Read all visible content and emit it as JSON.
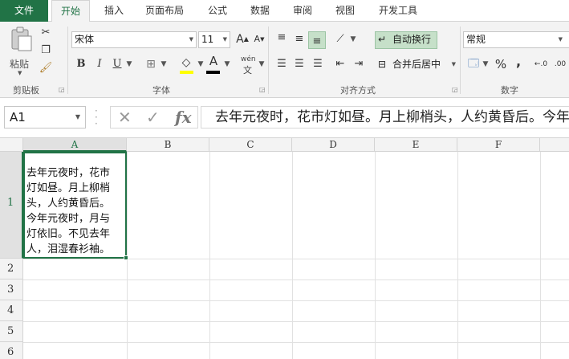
{
  "ribbon_tabs": [
    "文件",
    "开始",
    "插入",
    "页面布局",
    "公式",
    "数据",
    "审阅",
    "视图",
    "开发工具"
  ],
  "clipboard": {
    "paste_label": "粘贴",
    "group_label": "剪贴板"
  },
  "font": {
    "name": "宋体",
    "size": "11",
    "group_label": "字体",
    "bold": "B",
    "italic": "I",
    "underline": "U",
    "font_color_letter": "A",
    "phonetic_label": "wén"
  },
  "alignment": {
    "wrap_text": "自动换行",
    "merge_center": "合并后居中",
    "group_label": "对齐方式"
  },
  "number": {
    "format": "常规",
    "percent": "%",
    "comma": ",",
    "group_label": "数字"
  },
  "name_box": "A1",
  "formula_text": "去年元夜时，花市灯如昼。月上柳梢头，人约黄昏后。今年元夜时，月与灯依旧。不见去年人，泪湿春衫袖。",
  "columns": [
    "A",
    "B",
    "C",
    "D",
    "E",
    "F"
  ],
  "rows": [
    "1",
    "2",
    "3",
    "4",
    "5",
    "6"
  ],
  "cell_a1_lines": [
    "去年元夜时，花市",
    "灯如昼。月上柳梢",
    "头，人约黄昏后。",
    "今年元夜时，月与",
    "灯依旧。不见去年",
    "人，泪湿春衫袖。"
  ],
  "colors": {
    "accent": "#217346",
    "ribbon_bg": "#f3f3f3",
    "font_color_bar": "#000000"
  }
}
